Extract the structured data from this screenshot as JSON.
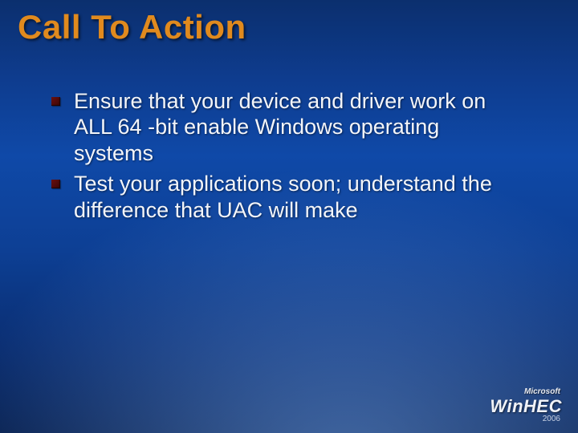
{
  "title": "Call To Action",
  "bullets": [
    "Ensure that your device and driver work on ALL 64 -bit enable Windows operating systems",
    "Test your applications soon; understand the difference that UAC will make"
  ],
  "footer": {
    "brand_small": "Microsoft",
    "brand_main": "WinHEC",
    "year": "2006"
  }
}
